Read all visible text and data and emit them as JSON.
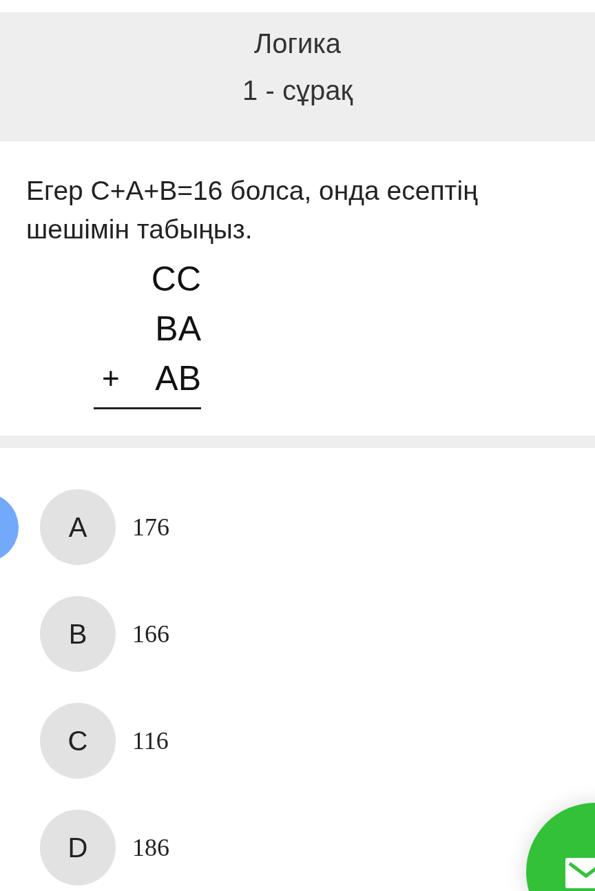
{
  "header": {
    "title": "Логика",
    "subtitle": "1 - сұрақ"
  },
  "question": {
    "text": "Егер С+А+В=16 болса, онда есептің шешімін табыңыз.",
    "sum": {
      "operator": "+",
      "addends": [
        "CC",
        "BA",
        "AB"
      ]
    }
  },
  "options": [
    {
      "letter": "A",
      "value": "176"
    },
    {
      "letter": "B",
      "value": "166"
    },
    {
      "letter": "C",
      "value": "116"
    },
    {
      "letter": "D",
      "value": "186"
    }
  ]
}
